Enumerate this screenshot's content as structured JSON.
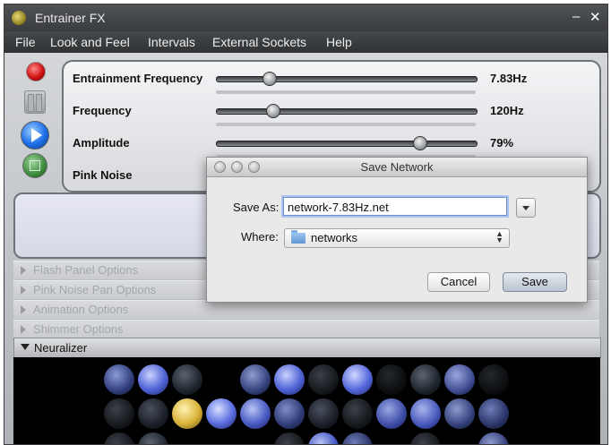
{
  "window": {
    "title": "Entrainer FX",
    "minimize_label": "–",
    "close_label": "✕"
  },
  "menu": {
    "items": [
      "File",
      "Look and Feel",
      "Intervals",
      "External Sockets",
      "Help"
    ]
  },
  "controls": {
    "rows": [
      {
        "label": "Entrainment Frequency",
        "value": "7.83Hz"
      },
      {
        "label": "Frequency",
        "value": "120Hz"
      },
      {
        "label": "Amplitude",
        "value": "79%"
      },
      {
        "label": "Pink Noise",
        "value": ""
      }
    ]
  },
  "sections": {
    "collapsed": [
      "Flash Panel Options",
      "Pink Noise Pan Options",
      "Animation Options",
      "Shimmer Options"
    ],
    "expanded": "Neuralizer"
  },
  "dialog": {
    "title": "Save Network",
    "save_as_label": "Save As:",
    "save_as_value": "network-7.83Hz.net",
    "where_label": "Where:",
    "where_value": "networks",
    "cancel_label": "Cancel",
    "save_label": "Save"
  },
  "icons": {
    "record": "record-icon",
    "pause": "pause-icon",
    "play": "play-icon",
    "stop": "stop-icon",
    "folder": "folder-icon"
  },
  "colors": {
    "accent_blue": "#1d6ee8",
    "orb_blue": "#4f63d6",
    "orb_gold": "#d9b23a",
    "record_red": "#d01010"
  }
}
